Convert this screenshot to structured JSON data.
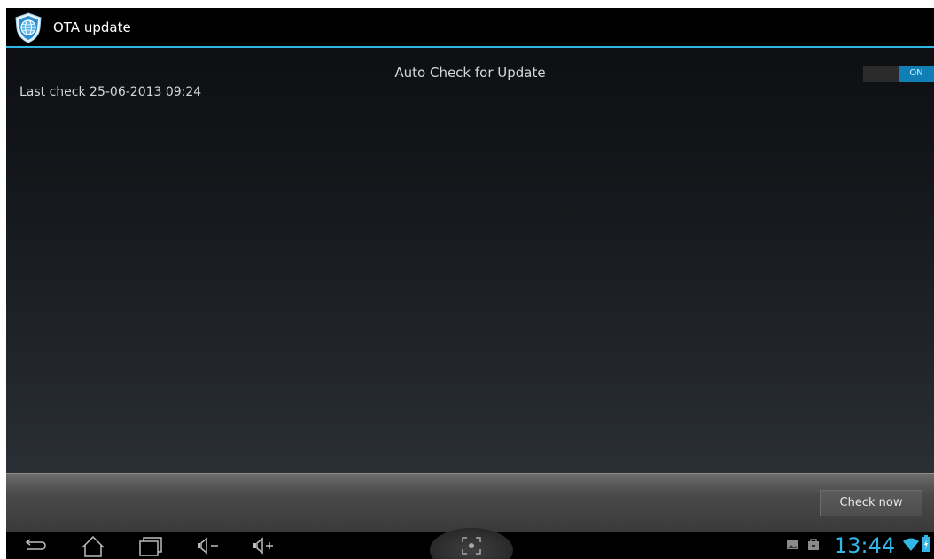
{
  "header": {
    "title": "OTA update",
    "app_icon": "ota-shield-globe-icon"
  },
  "settings": {
    "auto_check_label": "Auto Check for Update",
    "last_check": "Last check 25-06-2013 09:24",
    "toggle_state": "ON"
  },
  "actions": {
    "check_now_label": "Check now"
  },
  "system_bar": {
    "nav_icons": [
      "back-icon",
      "home-icon",
      "recent-apps-icon",
      "volume-down-icon",
      "volume-up-icon",
      "screenshot-icon"
    ],
    "status_icons": [
      "gallery-notification-icon",
      "store-notification-icon",
      "wifi-icon",
      "battery-icon"
    ],
    "time": "13:44"
  },
  "colors": {
    "accent": "#33b5e5",
    "toggle_on": "#0f7fb6"
  }
}
